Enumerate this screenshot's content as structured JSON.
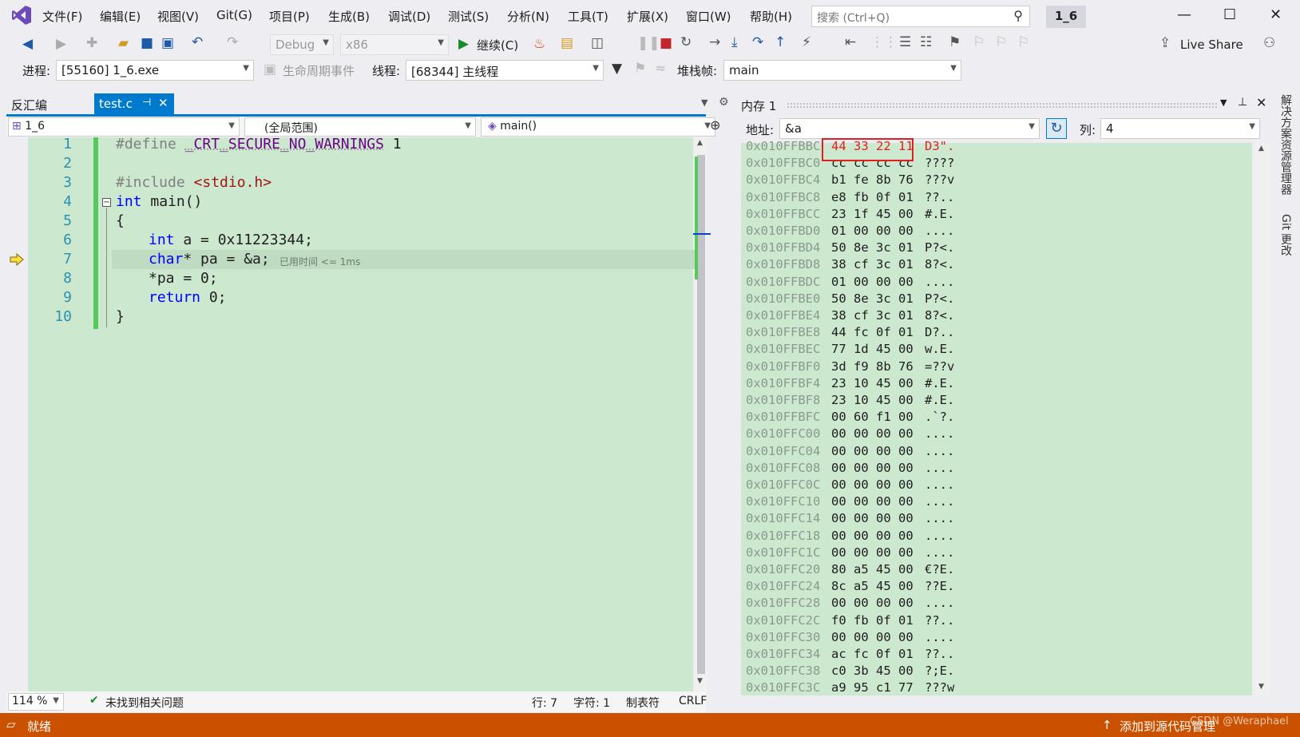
{
  "app": {
    "logo": "visual-studio-logo",
    "solution_name": "1_6"
  },
  "menu": [
    "文件(F)",
    "编辑(E)",
    "视图(V)",
    "Git(G)",
    "项目(P)",
    "生成(B)",
    "调试(D)",
    "测试(S)",
    "分析(N)",
    "工具(T)",
    "扩展(X)",
    "窗口(W)",
    "帮助(H)"
  ],
  "search": {
    "placeholder": "搜索 (Ctrl+Q)"
  },
  "toolbar": {
    "config": "Debug",
    "platform": "x86",
    "continue_label": "继续(C)",
    "live_share": "Live Share"
  },
  "debug_location": {
    "process_label": "进程:",
    "process_value": "[55160] 1_6.exe",
    "lifecycle_label": "生命周期事件",
    "thread_label": "线程:",
    "thread_value": "[68344] 主线程",
    "stack_label": "堆栈帧:",
    "stack_value": "main"
  },
  "tabs": {
    "disassembly": "反汇编",
    "file": "test.c"
  },
  "editor_nav": {
    "project": "1_6",
    "scope": "(全局范围)",
    "function": "main()"
  },
  "code": {
    "line_numbers": [
      "1",
      "2",
      "3",
      "4",
      "5",
      "6",
      "7",
      "8",
      "9",
      "10"
    ],
    "l1_kw": "#define",
    "l1_macro": "_CRT_SECURE_NO_WARNINGS",
    "l1_val": "1",
    "l3_kw": "#include",
    "l3_str": "<stdio.h>",
    "l4_kw": "int",
    "l4_rest": "main()",
    "l5": "{",
    "l6_kw": "int",
    "l6_rest": "a = 0x11223344;",
    "l7_kw": "char",
    "l7_rest": "* pa = &a;",
    "l7_elapsed": "已用时间 <= 1ms",
    "l8": "*pa = 0;",
    "l9_kw": "return",
    "l9_rest": "0;",
    "l10": "}"
  },
  "editor_status": {
    "zoom": "114 %",
    "issues": "未找到相关问题",
    "line": "行: 7",
    "char": "字符: 1",
    "tab": "制表符",
    "eol": "CRLF"
  },
  "memory": {
    "title": "内存 1",
    "address_label": "地址:",
    "address_value": "&a",
    "columns_label": "列:",
    "columns_value": "4",
    "rows": [
      {
        "addr": "0x010FFBBC",
        "bytes": "44 33 22 11",
        "ascii": "D3\"."
      },
      {
        "addr": "0x010FFBC0",
        "bytes": "cc cc cc cc",
        "ascii": "????"
      },
      {
        "addr": "0x010FFBC4",
        "bytes": "b1 fe 8b 76",
        "ascii": "???v"
      },
      {
        "addr": "0x010FFBC8",
        "bytes": "e8 fb 0f 01",
        "ascii": "??.."
      },
      {
        "addr": "0x010FFBCC",
        "bytes": "23 1f 45 00",
        "ascii": "#.E."
      },
      {
        "addr": "0x010FFBD0",
        "bytes": "01 00 00 00",
        "ascii": "...."
      },
      {
        "addr": "0x010FFBD4",
        "bytes": "50 8e 3c 01",
        "ascii": "P?<."
      },
      {
        "addr": "0x010FFBD8",
        "bytes": "38 cf 3c 01",
        "ascii": "8?<."
      },
      {
        "addr": "0x010FFBDC",
        "bytes": "01 00 00 00",
        "ascii": "...."
      },
      {
        "addr": "0x010FFBE0",
        "bytes": "50 8e 3c 01",
        "ascii": "P?<."
      },
      {
        "addr": "0x010FFBE4",
        "bytes": "38 cf 3c 01",
        "ascii": "8?<."
      },
      {
        "addr": "0x010FFBE8",
        "bytes": "44 fc 0f 01",
        "ascii": "D?.."
      },
      {
        "addr": "0x010FFBEC",
        "bytes": "77 1d 45 00",
        "ascii": "w.E."
      },
      {
        "addr": "0x010FFBF0",
        "bytes": "3d f9 8b 76",
        "ascii": "=??v"
      },
      {
        "addr": "0x010FFBF4",
        "bytes": "23 10 45 00",
        "ascii": "#.E."
      },
      {
        "addr": "0x010FFBF8",
        "bytes": "23 10 45 00",
        "ascii": "#.E."
      },
      {
        "addr": "0x010FFBFC",
        "bytes": "00 60 f1 00",
        "ascii": ".`?."
      },
      {
        "addr": "0x010FFC00",
        "bytes": "00 00 00 00",
        "ascii": "...."
      },
      {
        "addr": "0x010FFC04",
        "bytes": "00 00 00 00",
        "ascii": "...."
      },
      {
        "addr": "0x010FFC08",
        "bytes": "00 00 00 00",
        "ascii": "...."
      },
      {
        "addr": "0x010FFC0C",
        "bytes": "00 00 00 00",
        "ascii": "...."
      },
      {
        "addr": "0x010FFC10",
        "bytes": "00 00 00 00",
        "ascii": "...."
      },
      {
        "addr": "0x010FFC14",
        "bytes": "00 00 00 00",
        "ascii": "...."
      },
      {
        "addr": "0x010FFC18",
        "bytes": "00 00 00 00",
        "ascii": "...."
      },
      {
        "addr": "0x010FFC1C",
        "bytes": "00 00 00 00",
        "ascii": "...."
      },
      {
        "addr": "0x010FFC20",
        "bytes": "80 a5 45 00",
        "ascii": "€?E."
      },
      {
        "addr": "0x010FFC24",
        "bytes": "8c a5 45 00",
        "ascii": "??E."
      },
      {
        "addr": "0x010FFC28",
        "bytes": "00 00 00 00",
        "ascii": "...."
      },
      {
        "addr": "0x010FFC2C",
        "bytes": "f0 fb 0f 01",
        "ascii": "??.."
      },
      {
        "addr": "0x010FFC30",
        "bytes": "00 00 00 00",
        "ascii": "...."
      },
      {
        "addr": "0x010FFC34",
        "bytes": "ac fc 0f 01",
        "ascii": "??.."
      },
      {
        "addr": "0x010FFC38",
        "bytes": "c0 3b 45 00",
        "ascii": "?;E."
      },
      {
        "addr": "0x010FFC3C",
        "bytes": "a9 95 c1 77",
        "ascii": "???w"
      }
    ]
  },
  "side_tabs": [
    "解决方案资源管理器",
    "Git 更改"
  ],
  "statusbar": {
    "ready": "就绪",
    "source_control": "添加到源代码管理",
    "watermark": "CSDN @Weraphael"
  },
  "colors": {
    "accent": "#007acc",
    "status": "#ca5100",
    "code_bg": "#cce8cf",
    "keyword": "#0000ff",
    "macro": "#6f008a",
    "string": "#a31515",
    "highlight": "#e02020"
  }
}
